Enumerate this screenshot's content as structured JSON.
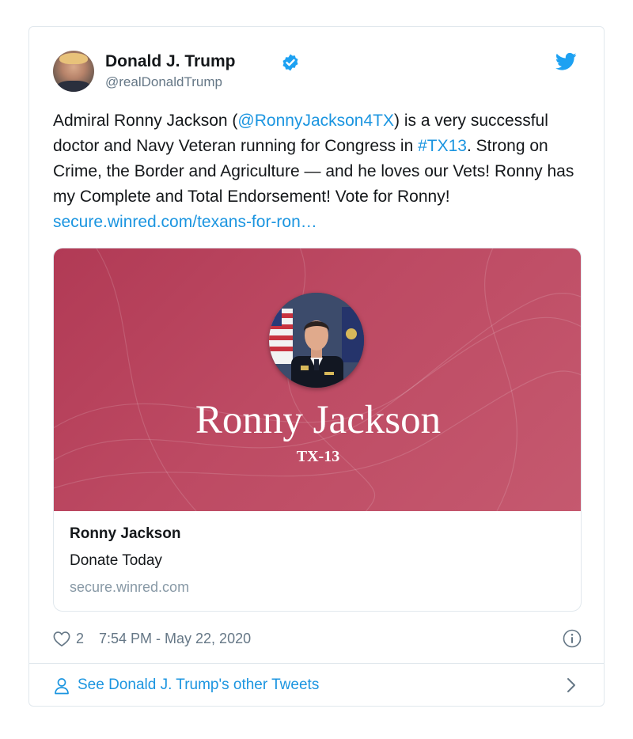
{
  "author": {
    "name": "Donald J. Trump",
    "handle": "@realDonaldTrump",
    "verified": true
  },
  "tweet": {
    "text_parts": {
      "p1": "Admiral Ronny Jackson (",
      "mention": "@RonnyJackson4TX",
      "p2": ") is a very successful doctor and Navy Veteran running for Congress in ",
      "hashtag": "#TX13",
      "p3": ". Strong on Crime, the Border and Agriculture — and he loves our Vets! Ronny has my Complete and Total Endorsement! Vote for Ronny! ",
      "link": "secure.winred.com/texans-for-ron…"
    }
  },
  "card": {
    "banner_name": "Ronny Jackson",
    "banner_district": "TX-13",
    "title": "Ronny Jackson",
    "description": "Donate Today",
    "domain": "secure.winred.com"
  },
  "meta": {
    "like_count": "2",
    "timestamp": "7:54 PM - May 22, 2020"
  },
  "footer": {
    "see_more_label": "See Donald J. Trump's other Tweets"
  },
  "colors": {
    "link": "#1b95e0",
    "banner": "#b83f5b",
    "secondary_text": "#657786"
  },
  "icons": {
    "verified": "verified-badge-icon",
    "logo": "twitter-bird-icon",
    "like": "heart-icon",
    "info": "info-icon",
    "profile": "person-icon",
    "chevron": "chevron-right-icon"
  }
}
